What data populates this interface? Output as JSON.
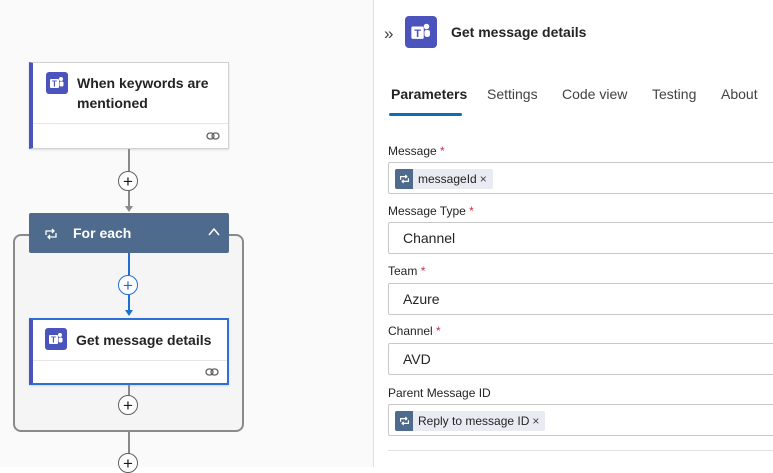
{
  "canvas": {
    "trigger_card": {
      "title": "When keywords are mentioned",
      "icon": "teams-icon"
    },
    "foreach": {
      "label": "For each",
      "loop_icon": "loop-icon",
      "collapse_icon": "chevron-up-icon"
    },
    "action_card": {
      "title": "Get message details",
      "icon": "teams-icon"
    },
    "add_step_symbol": "+",
    "link_icon": "link-icon"
  },
  "panel": {
    "expand_icon": "»",
    "title": "Get message details",
    "tabs": [
      {
        "label": "Parameters",
        "active": true
      },
      {
        "label": "Settings",
        "active": false
      },
      {
        "label": "Code view",
        "active": false
      },
      {
        "label": "Testing",
        "active": false
      },
      {
        "label": "About",
        "active": false
      }
    ],
    "fields": {
      "message": {
        "label": "Message",
        "required": "*",
        "token": "messageId",
        "remove": "×"
      },
      "message_type": {
        "label": "Message Type",
        "required": "*",
        "value": "Channel"
      },
      "team": {
        "label": "Team",
        "required": "*",
        "value": "Azure"
      },
      "channel": {
        "label": "Channel",
        "required": "*",
        "value": "AVD"
      },
      "parent_message_id": {
        "label": "Parent Message ID",
        "token": "Reply to message ID",
        "remove": "×"
      }
    }
  },
  "colors": {
    "teams_purple": "#4b53bc",
    "loop_header": "#4e6a8c",
    "accent_blue": "#0f6cbd",
    "selected_border": "#2e6fd8",
    "required_red": "#c4314b"
  }
}
